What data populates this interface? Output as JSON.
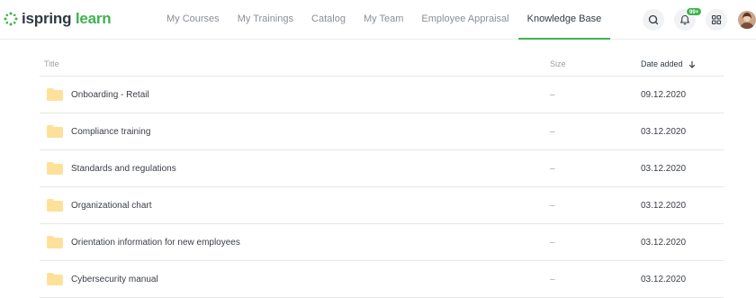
{
  "app": {
    "logo_primary": "ispring",
    "logo_secondary": "learn",
    "brand_color": "#3fb34f"
  },
  "nav": {
    "items": [
      {
        "label": "My Courses",
        "active": false
      },
      {
        "label": "My Trainings",
        "active": false
      },
      {
        "label": "Catalog",
        "active": false
      },
      {
        "label": "My Team",
        "active": false
      },
      {
        "label": "Employee Appraisal",
        "active": false
      },
      {
        "label": "Knowledge Base",
        "active": true
      }
    ]
  },
  "header_icons": {
    "search_icon": "search-icon",
    "notifications_icon": "bell-icon",
    "notifications_badge": "99+",
    "apps_icon": "grid-icon",
    "avatar": "user-avatar"
  },
  "table": {
    "columns": {
      "title": "Title",
      "size": "Size",
      "date": "Date added"
    },
    "sort_icon": "arrow-down-icon",
    "rows": [
      {
        "name": "Onboarding - Retail",
        "size": "–",
        "date": "09.12.2020"
      },
      {
        "name": "Compliance training",
        "size": "–",
        "date": "03.12.2020"
      },
      {
        "name": "Standards and regulations",
        "size": "–",
        "date": "03.12.2020"
      },
      {
        "name": "Organizational chart",
        "size": "–",
        "date": "03.12.2020"
      },
      {
        "name": "Orientation information for new employees",
        "size": "–",
        "date": "03.12.2020"
      },
      {
        "name": "Cybersecurity manual",
        "size": "–",
        "date": "03.12.2020"
      }
    ]
  }
}
